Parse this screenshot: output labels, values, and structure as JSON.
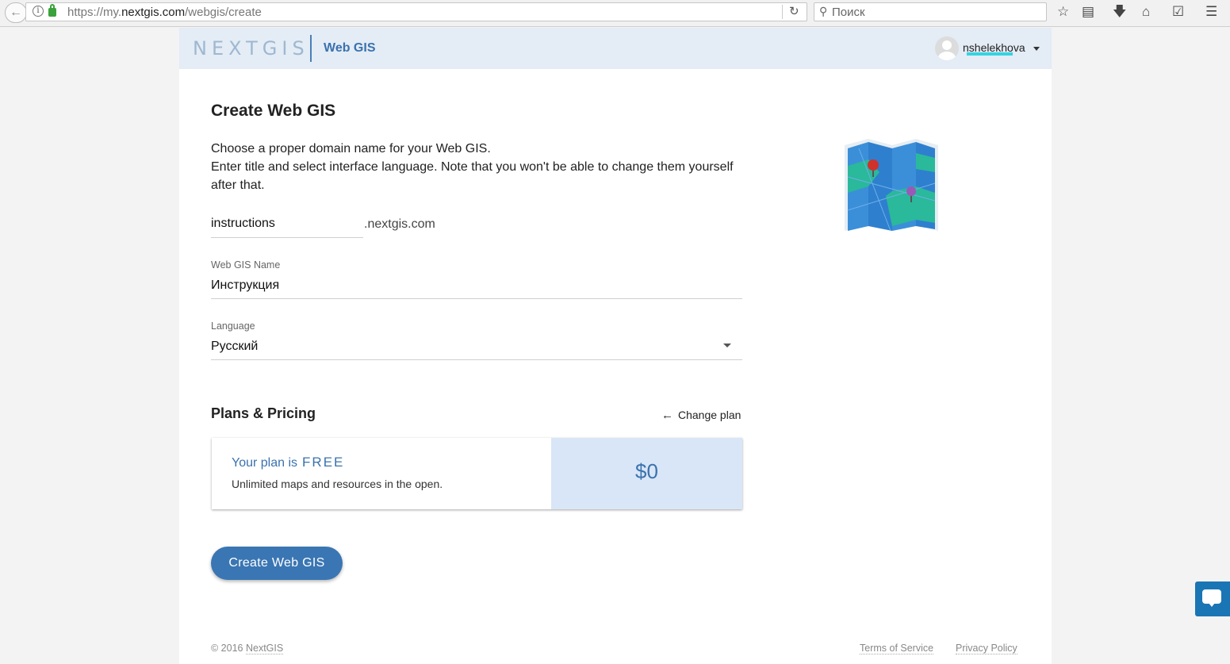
{
  "browser": {
    "url_prefix": "https://my.",
    "url_domain": "nextgis.com",
    "url_path": "/webgis/create",
    "search_placeholder": "Поиск"
  },
  "header": {
    "logo": "NEXTGIS",
    "product": "Web GIS",
    "username": "nshelekhova"
  },
  "form": {
    "title": "Create Web GIS",
    "intro_line1": "Choose a proper domain name for your Web GIS.",
    "intro_line2": "Enter title and select interface language. Note that you won't be able to change them yourself after that.",
    "domain_value": "instructions",
    "domain_suffix": ".nextgis.com",
    "name_label": "Web GIS Name",
    "name_value": "Инструкция",
    "language_label": "Language",
    "language_value": "Русский"
  },
  "plans": {
    "title": "Plans & Pricing",
    "change_plan": "Change plan",
    "plan_prefix": "Your plan is",
    "plan_level": "FREE",
    "plan_desc": "Unlimited maps and resources in the open.",
    "price": "$0"
  },
  "actions": {
    "create_button": "Create Web GIS"
  },
  "footer": {
    "copyright": "© 2016",
    "company": "NextGIS",
    "terms": "Terms of Service",
    "privacy": "Privacy Policy"
  },
  "colors": {
    "accent": "#3a76b3",
    "header_bg": "#e4ecf6",
    "price_bg": "#d9e6f7"
  }
}
